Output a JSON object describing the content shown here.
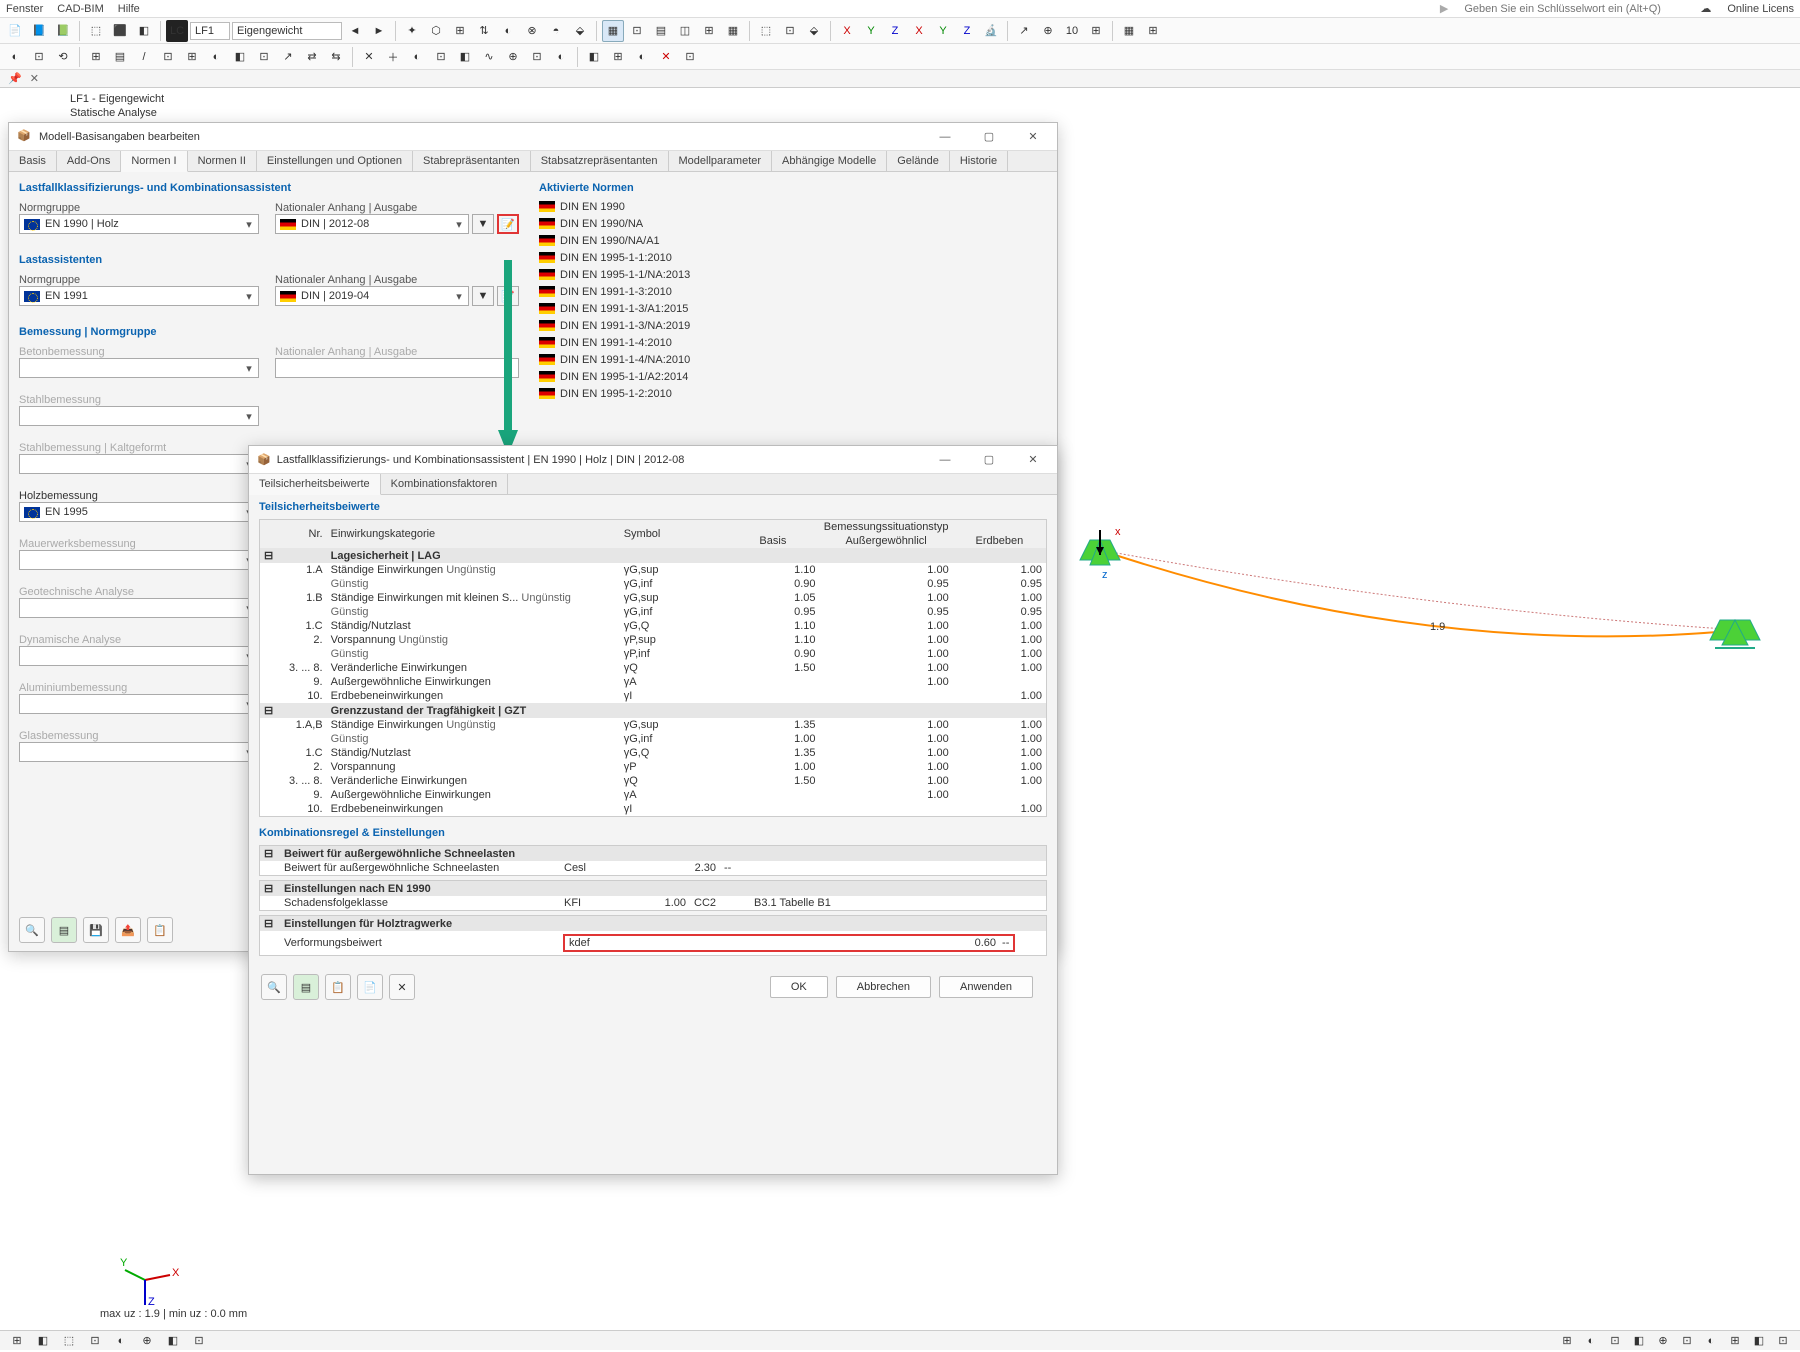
{
  "menubar": {
    "items": [
      "Fenster",
      "CAD-BIM",
      "Hilfe"
    ],
    "search_placeholder": "Geben Sie ein Schlüsselwort ein (Alt+Q)",
    "license": "Online Licens"
  },
  "toolbar2": {
    "lc": "LC",
    "lf": "LF1",
    "lfname": "Eigengewicht"
  },
  "doctab": {
    "label": ""
  },
  "info": {
    "l1": "LF1 - Eigengewicht",
    "l2": "Statische Analyse"
  },
  "dialog1": {
    "title": "Modell-Basisangaben bearbeiten",
    "tabs": [
      "Basis",
      "Add-Ons",
      "Normen I",
      "Normen II",
      "Einstellungen und Optionen",
      "Stabrepräsentanten",
      "Stabsatzrepräsentanten",
      "Modellparameter",
      "Abhängige Modelle",
      "Gelände",
      "Historie"
    ],
    "sec1": "Lastfallklassifizierungs- und Kombinationsassistent",
    "normgruppe_lbl": "Normgruppe",
    "anhang_lbl": "Nationaler Anhang | Ausgabe",
    "norm1": "EN 1990 | Holz",
    "anhang1": "DIN | 2012-08",
    "sec2": "Lastassistenten",
    "norm2": "EN 1991",
    "anhang2": "DIN | 2019-04",
    "sec3": "Bemessung | Normgruppe",
    "dim_items": [
      "Betonbemessung",
      "Stahlbemessung",
      "Stahlbemessung | Kaltgeformt"
    ],
    "holz_lbl": "Holzbemessung",
    "holz_norm": "EN 1995",
    "dim_items2": [
      "Mauerwerksbemessung",
      "Geotechnische Analyse",
      "Dynamische Analyse",
      "Aluminiumbemessung",
      "Glasbemessung"
    ],
    "aktiv": "Aktivierte Normen",
    "norms": [
      "DIN EN 1990",
      "DIN EN 1990/NA",
      "DIN EN 1990/NA/A1",
      "DIN EN 1995-1-1:2010",
      "DIN EN 1995-1-1/NA:2013",
      "DIN EN 1991-1-3:2010",
      "DIN EN 1991-1-3/A1:2015",
      "DIN EN 1991-1-3/NA:2019",
      "DIN EN 1991-1-4:2010",
      "DIN EN 1991-1-4/NA:2010",
      "DIN EN 1995-1-1/A2:2014",
      "DIN EN 1995-1-2:2010"
    ]
  },
  "dialog2": {
    "title": "Lastfallklassifizierungs- und Kombinationsassistent | EN 1990 | Holz | DIN | 2012-08",
    "tabs": [
      "Teilsicherheitsbeiwerte",
      "Kombinationsfaktoren"
    ],
    "sec": "Teilsicherheitsbeiwerte",
    "hdr": {
      "nr": "Nr.",
      "kat": "Einwirkungskategorie",
      "sym": "Symbol",
      "basis": "Basis",
      "aus": "Außergewöhnlicl",
      "erd": "Erdbeben",
      "bem": "Bemessungssituationstyp"
    },
    "g1": "Lagesicherheit | LAG",
    "rows1": [
      {
        "nr": "1.A",
        "kat": "Ständige Einwirkungen",
        "typ": "Ungünstig",
        "sym": "γG,sup",
        "b": "1.10",
        "a": "1.00",
        "e": "1.00"
      },
      {
        "nr": "",
        "kat": "",
        "typ": "Günstig",
        "sym": "γG,inf",
        "b": "0.90",
        "a": "0.95",
        "e": "0.95"
      },
      {
        "nr": "1.B",
        "kat": "Ständige Einwirkungen mit kleinen S...",
        "typ": "Ungünstig",
        "sym": "γG,sup",
        "b": "1.05",
        "a": "1.00",
        "e": "1.00"
      },
      {
        "nr": "",
        "kat": "",
        "typ": "Günstig",
        "sym": "γG,inf",
        "b": "0.95",
        "a": "0.95",
        "e": "0.95"
      },
      {
        "nr": "1.C",
        "kat": "Ständig/Nutzlast",
        "typ": "",
        "sym": "γG,Q",
        "b": "1.10",
        "a": "1.00",
        "e": "1.00"
      },
      {
        "nr": "2.",
        "kat": "Vorspannung",
        "typ": "Ungünstig",
        "sym": "γP,sup",
        "b": "1.10",
        "a": "1.00",
        "e": "1.00"
      },
      {
        "nr": "",
        "kat": "",
        "typ": "Günstig",
        "sym": "γP,inf",
        "b": "0.90",
        "a": "1.00",
        "e": "1.00"
      },
      {
        "nr": "3. ... 8.",
        "kat": "Veränderliche Einwirkungen",
        "typ": "",
        "sym": "γQ",
        "b": "1.50",
        "a": "1.00",
        "e": "1.00"
      },
      {
        "nr": "9.",
        "kat": "Außergewöhnliche Einwirkungen",
        "typ": "",
        "sym": "γA",
        "b": "",
        "a": "1.00",
        "e": ""
      },
      {
        "nr": "10.",
        "kat": "Erdbebeneinwirkungen",
        "typ": "",
        "sym": "γI",
        "b": "",
        "a": "",
        "e": "1.00"
      }
    ],
    "g2": "Grenzzustand der Tragfähigkeit | GZT",
    "rows2": [
      {
        "nr": "1.A,B",
        "kat": "Ständige Einwirkungen",
        "typ": "Ungünstig",
        "sym": "γG,sup",
        "b": "1.35",
        "a": "1.00",
        "e": "1.00"
      },
      {
        "nr": "",
        "kat": "",
        "typ": "Günstig",
        "sym": "γG,inf",
        "b": "1.00",
        "a": "1.00",
        "e": "1.00"
      },
      {
        "nr": "1.C",
        "kat": "Ständig/Nutzlast",
        "typ": "",
        "sym": "γG,Q",
        "b": "1.35",
        "a": "1.00",
        "e": "1.00"
      },
      {
        "nr": "2.",
        "kat": "Vorspannung",
        "typ": "",
        "sym": "γP",
        "b": "1.00",
        "a": "1.00",
        "e": "1.00"
      },
      {
        "nr": "3. ... 8.",
        "kat": "Veränderliche Einwirkungen",
        "typ": "",
        "sym": "γQ",
        "b": "1.50",
        "a": "1.00",
        "e": "1.00"
      },
      {
        "nr": "9.",
        "kat": "Außergewöhnliche Einwirkungen",
        "typ": "",
        "sym": "γA",
        "b": "",
        "a": "1.00",
        "e": ""
      },
      {
        "nr": "10.",
        "kat": "Erdbebeneinwirkungen",
        "typ": "",
        "sym": "γI",
        "b": "",
        "a": "",
        "e": "1.00"
      }
    ],
    "sec2": "Kombinationsregel & Einstellungen",
    "snow_hdr": "Beiwert für außergewöhnliche Schneelasten",
    "snow_lbl": "Beiwert für außergewöhnliche Schneelasten",
    "snow_sym": "Cesl",
    "snow_val": "2.30",
    "snow_u": "--",
    "en_hdr": "Einstellungen nach EN 1990",
    "en_lbl": "Schadensfolgeklasse",
    "en_sym": "KFI",
    "en_val": "1.00",
    "en_cc": "CC2",
    "en_ref": "B3.1 Tabelle B1",
    "holz_hdr": "Einstellungen für Holztragwerke",
    "holz_lbl": "Verformungsbeiwert",
    "holz_sym": "kdef",
    "holz_val": "0.60",
    "holz_u": "--",
    "ok": "OK",
    "cancel": "Abbrechen",
    "apply": "Anwenden"
  },
  "status": {
    "uz": "max uz : 1.9 | min uz : 0.0 mm",
    "dim": "1.9"
  }
}
